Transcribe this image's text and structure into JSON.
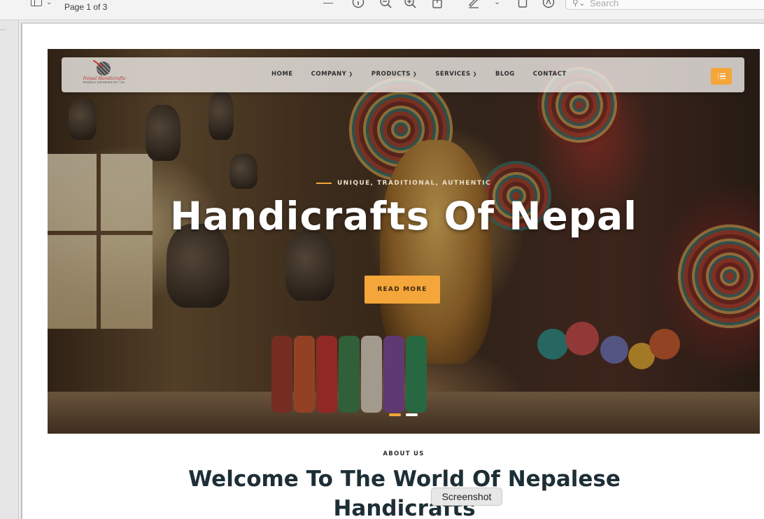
{
  "app": {
    "page_indicator": "Page 1 of 3",
    "search_placeholder": "Search",
    "tooltip": "Screenshot",
    "sidebar_dots": "..."
  },
  "site": {
    "logo_text": "Nepal Handicrafts",
    "logo_subtext": "PRODUCT EXPORTER PVT. LTD.",
    "nav": [
      {
        "label": "HOME",
        "has_caret": false
      },
      {
        "label": "COMPANY",
        "has_caret": true
      },
      {
        "label": "PRODUCTS",
        "has_caret": true
      },
      {
        "label": "SERVICES",
        "has_caret": true
      },
      {
        "label": "BLOG",
        "has_caret": false
      },
      {
        "label": "CONTACT",
        "has_caret": false
      }
    ],
    "accent_color": "#f4a63a",
    "hero": {
      "tagline": "UNIQUE, TRADITIONAL, AUTHENTIC",
      "title": "Handicrafts Of Nepal",
      "cta": "READ MORE",
      "slides": 2,
      "active_slide": 1
    },
    "about": {
      "label": "ABOUT US",
      "title": "Welcome To The World Of Nepalese Handicrafts"
    }
  }
}
